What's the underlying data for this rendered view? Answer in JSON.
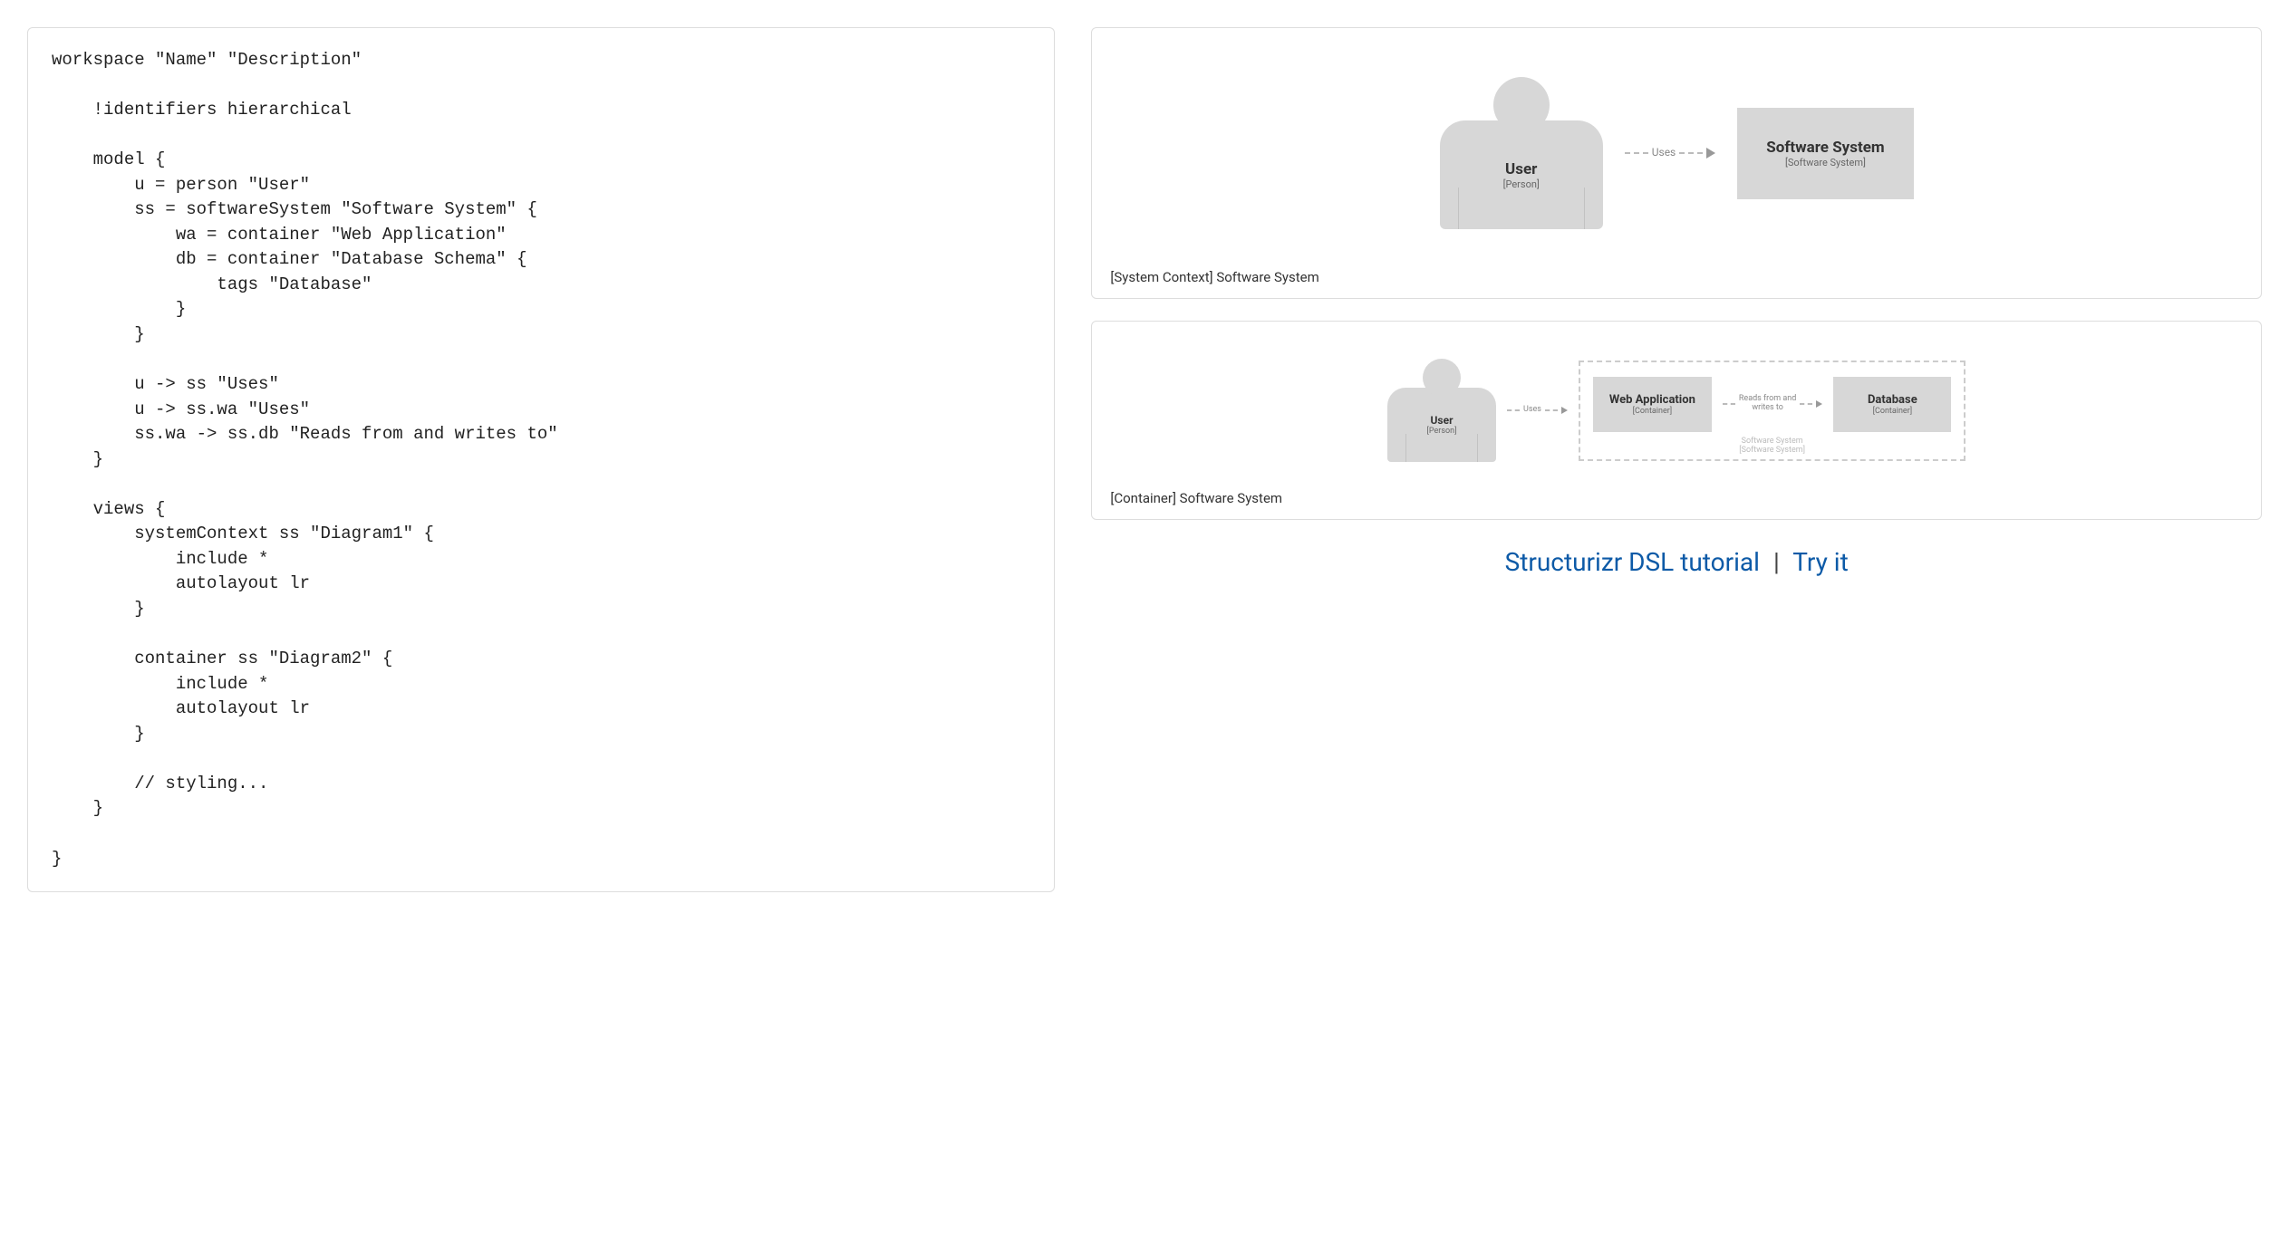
{
  "code": "workspace \"Name\" \"Description\"\n\n    !identifiers hierarchical\n\n    model {\n        u = person \"User\"\n        ss = softwareSystem \"Software System\" {\n            wa = container \"Web Application\"\n            db = container \"Database Schema\" {\n                tags \"Database\"\n            }\n        }\n\n        u -> ss \"Uses\"\n        u -> ss.wa \"Uses\"\n        ss.wa -> ss.db \"Reads from and writes to\"\n    }\n\n    views {\n        systemContext ss \"Diagram1\" {\n            include *\n            autolayout lr\n        }\n\n        container ss \"Diagram2\" {\n            include *\n            autolayout lr\n        }\n\n        // styling...\n    }\n\n}",
  "diagram1": {
    "caption": "[System Context] Software System",
    "user": {
      "title": "User",
      "sub": "[Person]"
    },
    "rel": "Uses",
    "system": {
      "title": "Software System",
      "sub": "[Software System]"
    }
  },
  "diagram2": {
    "caption": "[Container] Software System",
    "user": {
      "title": "User",
      "sub": "[Person]"
    },
    "rel1": "Uses",
    "wa": {
      "title": "Web Application",
      "sub": "[Container]"
    },
    "rel2": "Reads from and\nwrites to",
    "db": {
      "title": "Database",
      "sub": "[Container]"
    },
    "boundary": {
      "title": "Software System",
      "sub": "[Software System]"
    }
  },
  "links": {
    "tutorial": "Structurizr DSL tutorial",
    "sep": "|",
    "try": "Try it"
  }
}
